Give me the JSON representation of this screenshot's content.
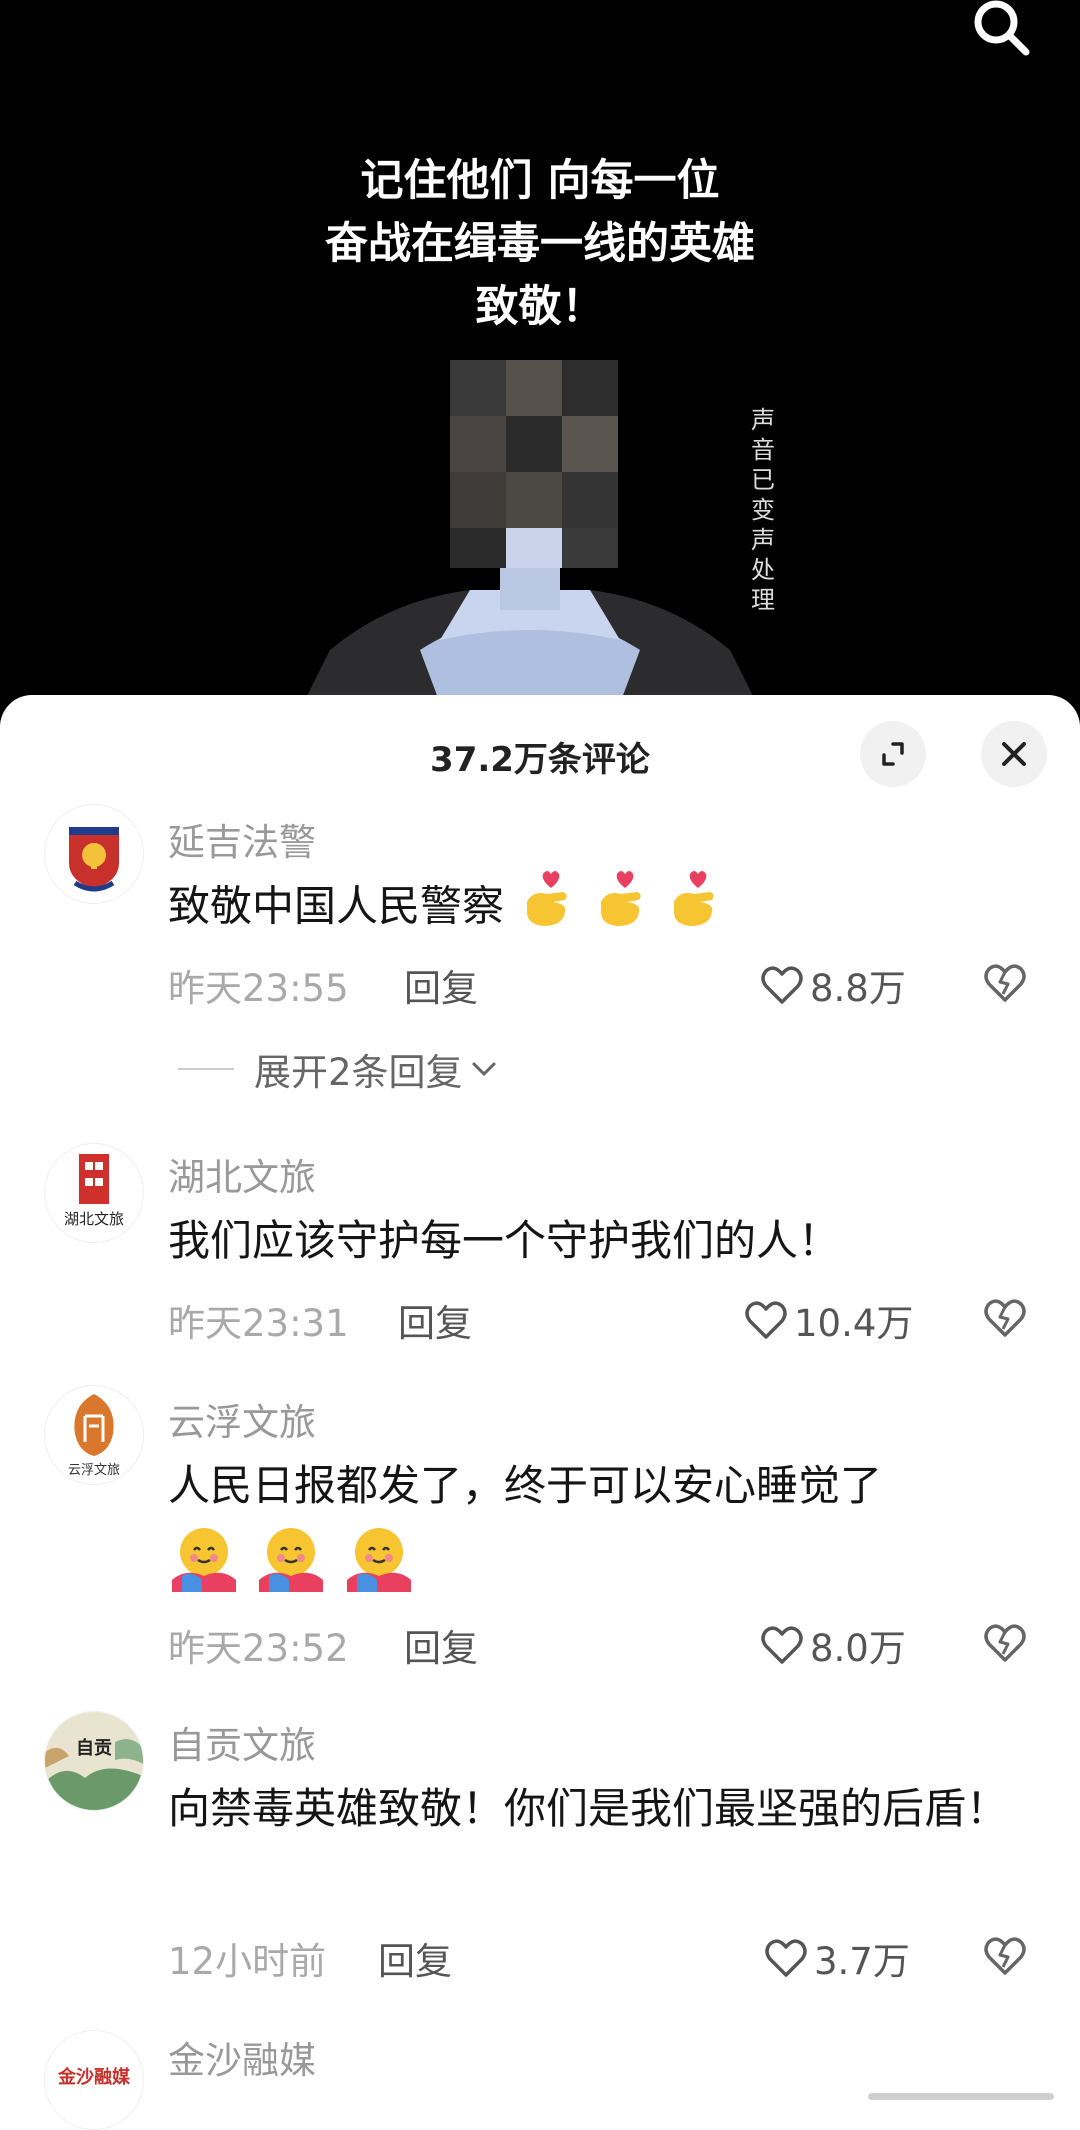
{
  "video": {
    "caption_lines": [
      "记住他们 向每一位",
      "奋战在缉毒一线的英雄",
      "致敬！"
    ],
    "voice_note": "声音已变声处理"
  },
  "comments_panel": {
    "title": "37.2万条评论",
    "reply_label": "回复",
    "comments": [
      {
        "user": "延吉法警",
        "text": "致敬中国人民警察",
        "time": "昨天23:55",
        "likes": "8.8万",
        "expand_replies": "展开2条回复"
      },
      {
        "user": "湖北文旅",
        "text": "我们应该守护每一个守护我们的人！",
        "time": "昨天23:31",
        "likes": "10.4万",
        "avatar_text": "湖北文旅"
      },
      {
        "user": "云浮文旅",
        "text": "人民日报都发了，终于可以安心睡觉了",
        "time": "昨天23:52",
        "likes": "8.0万",
        "avatar_text": "云浮文旅"
      },
      {
        "user": "自贡文旅",
        "text": "向禁毒英雄致敬！你们是我们最坚强的后盾！",
        "time": "12小时前",
        "likes": "3.7万",
        "avatar_text": "自贡"
      },
      {
        "user": "金沙融媒",
        "avatar_text": "金沙融媒"
      }
    ]
  },
  "colors": {
    "video_bg": "#000000",
    "sheet_bg": "#ffffff",
    "muted_text": "#999999",
    "body_text": "#151515"
  },
  "icons": [
    "search-icon",
    "expand-icon",
    "close-icon",
    "heart-icon",
    "broken-heart-icon",
    "chevron-down-icon",
    "finger-heart-emoji",
    "hug-emoji"
  ]
}
